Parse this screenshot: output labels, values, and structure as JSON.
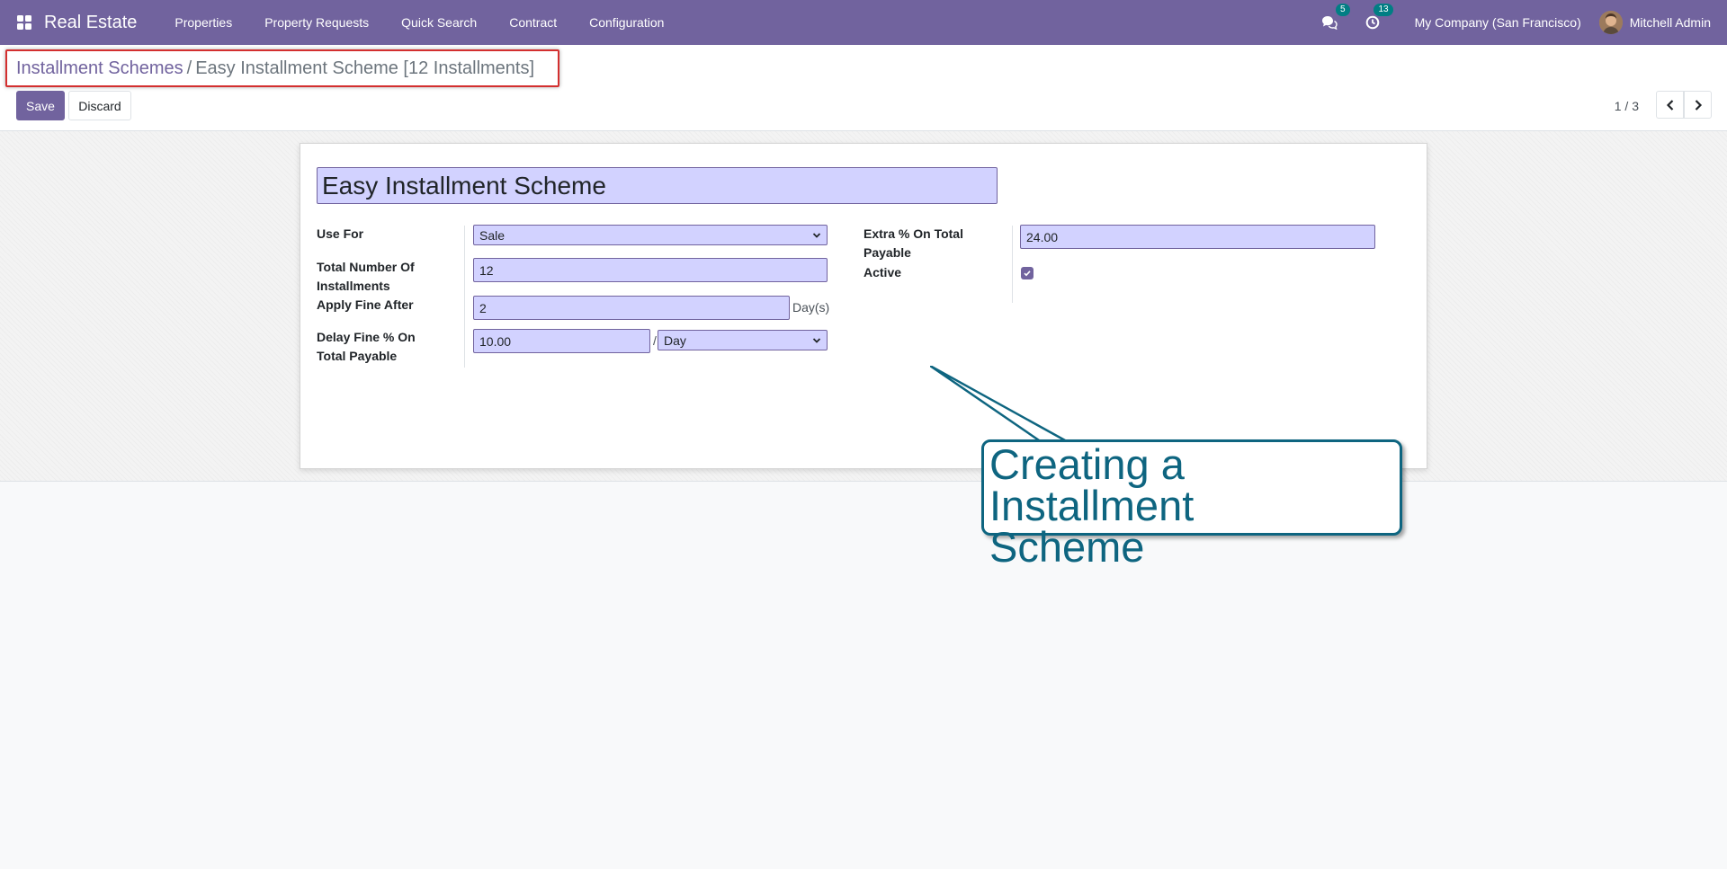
{
  "navbar": {
    "app_name": "Real Estate",
    "menu": [
      "Properties",
      "Property Requests",
      "Quick Search",
      "Contract",
      "Configuration"
    ],
    "messages_count": "5",
    "activities_count": "13",
    "company": "My Company (San Francisco)",
    "user": "Mitchell Admin",
    "accent_color": "#71639e"
  },
  "breadcrumb": {
    "parent": "Installment Schemes",
    "separator": "/",
    "current": "Easy Installment Scheme [12 Installments]"
  },
  "actions": {
    "save_label": "Save",
    "discard_label": "Discard"
  },
  "pager": {
    "text": "1 / 3"
  },
  "form": {
    "name": "Easy Installment Scheme",
    "use_for_label": "Use For",
    "use_for_value": "Sale",
    "total_installments_label_1": "Total Number Of",
    "total_installments_label_2": "Installments",
    "total_installments_value": "12",
    "apply_fine_after_label": "Apply Fine After",
    "apply_fine_after_value": "2",
    "apply_fine_after_unit": "Day(s)",
    "delay_fine_label_1": "Delay Fine % On",
    "delay_fine_label_2": "Total Payable",
    "delay_fine_value": "10.00",
    "delay_fine_sep": "/",
    "delay_fine_period": "Day",
    "extra_pct_label_1": "Extra % On Total",
    "extra_pct_label_2": "Payable",
    "extra_pct_value": "24.00",
    "active_label": "Active",
    "active_checked": true
  },
  "callout": {
    "line1": "Creating a Installment",
    "line2": "Scheme",
    "color": "#0e6580"
  }
}
